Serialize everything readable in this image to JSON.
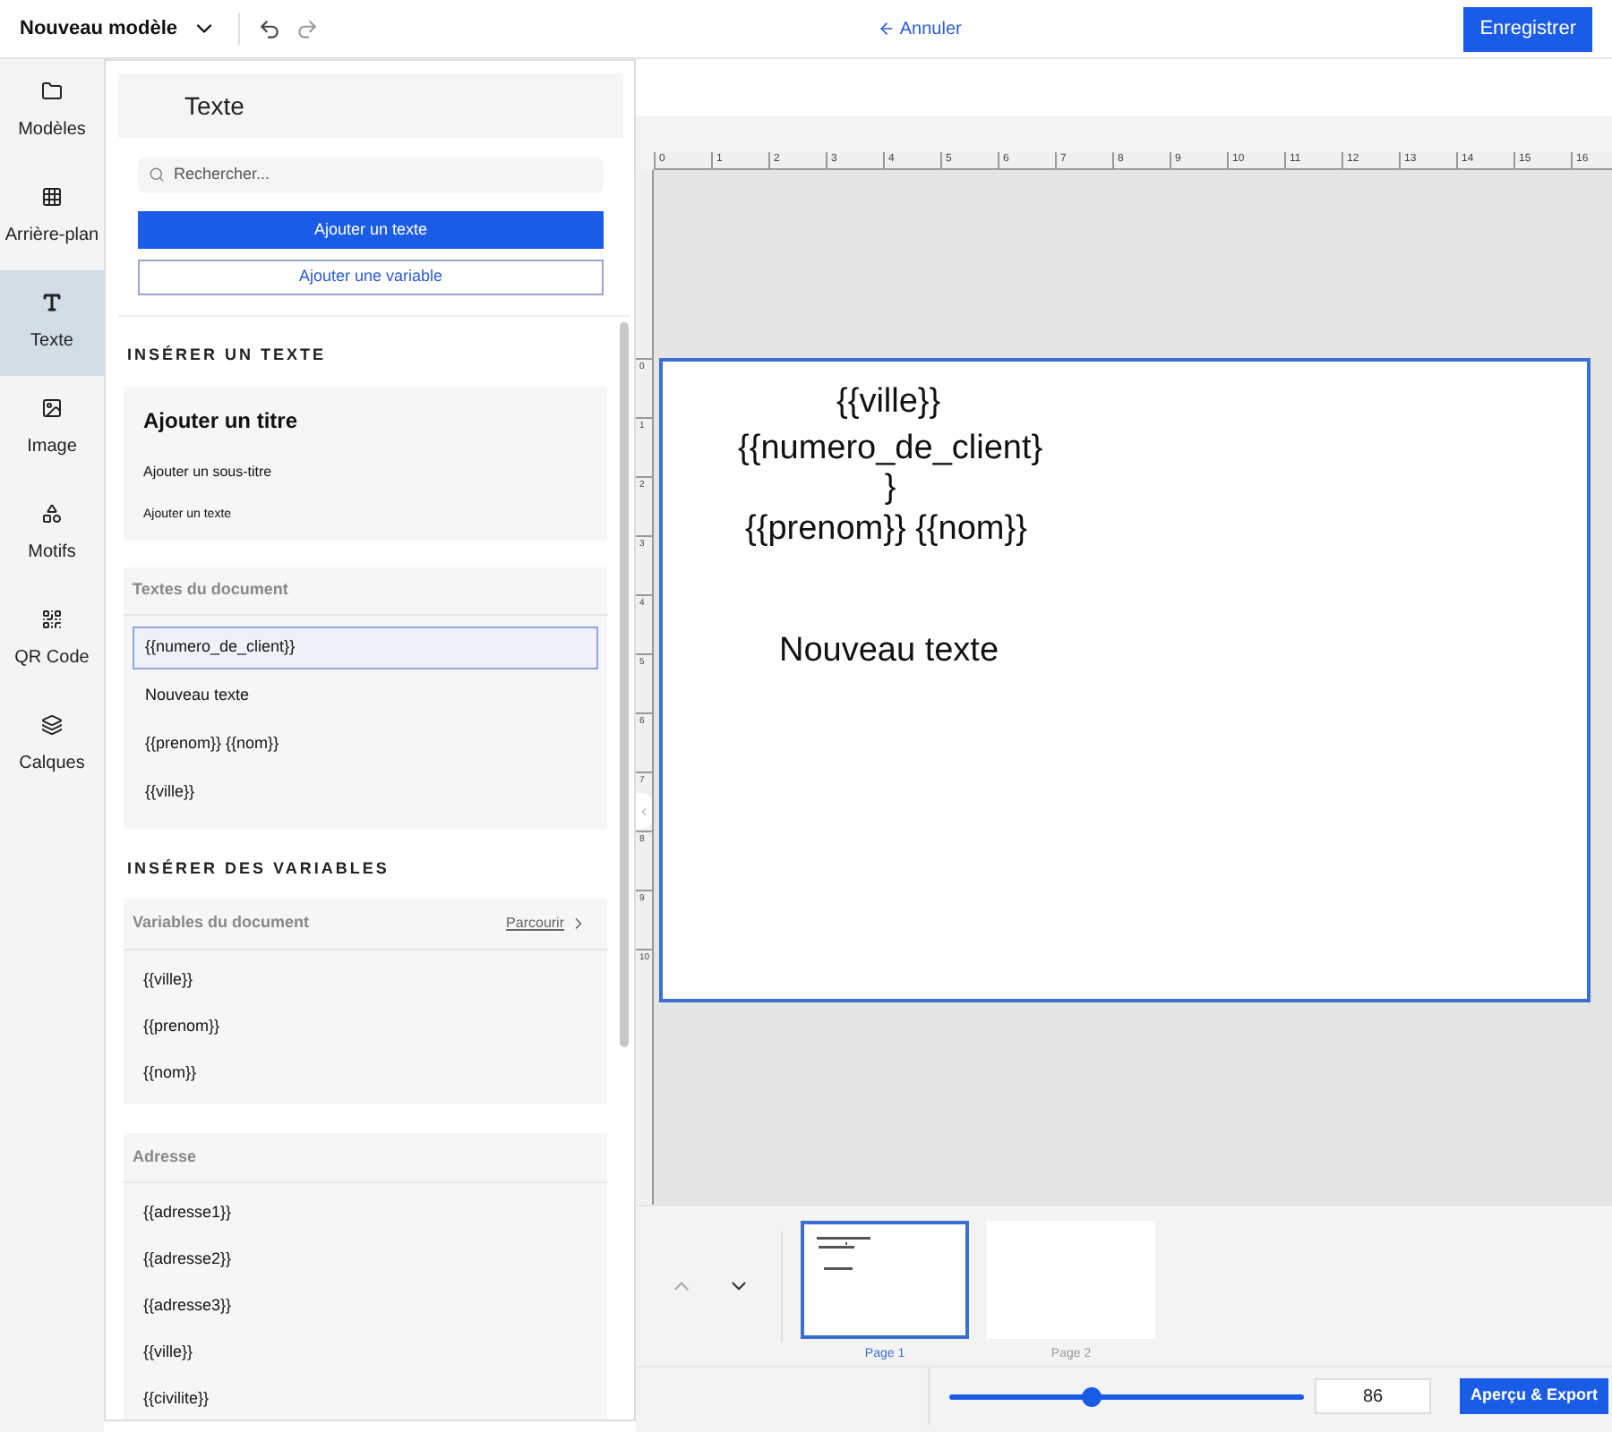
{
  "header": {
    "template_name": "Nouveau modèle",
    "cancel": "Annuler",
    "save": "Enregistrer"
  },
  "rail": [
    {
      "label": "Modèles",
      "selected": false
    },
    {
      "label": "Arrière-plan",
      "selected": false
    },
    {
      "label": "Texte",
      "selected": true
    },
    {
      "label": "Image",
      "selected": false
    },
    {
      "label": "Motifs",
      "selected": false
    },
    {
      "label": "QR Code",
      "selected": false
    },
    {
      "label": "Calques",
      "selected": false
    }
  ],
  "panel": {
    "title": "Texte",
    "search_placeholder": "Rechercher...",
    "primary_button": "Ajouter un texte",
    "secondary_button": "Ajouter une variable",
    "insert_text": {
      "heading": "INSÉRER UN TEXTE",
      "presets": [
        {
          "kind": "title",
          "label": "Ajouter un titre"
        },
        {
          "kind": "subtitle",
          "label": "Ajouter un sous-titre"
        },
        {
          "kind": "body",
          "label": "Ajouter un texte"
        }
      ]
    },
    "document_texts": {
      "title": "Textes du document",
      "items": [
        {
          "label": "{{numero_de_client}}",
          "selected": true
        },
        {
          "label": "Nouveau texte",
          "selected": false
        },
        {
          "label": "{{prenom}} {{nom}}",
          "selected": false
        },
        {
          "label": "{{ville}}",
          "selected": false
        }
      ]
    },
    "insert_variables": {
      "heading": "INSÉRER DES VARIABLES",
      "groups": [
        {
          "title": "Variables du document",
          "link": "Parcourir",
          "items": [
            "{{ville}}",
            "{{prenom}}",
            "{{nom}}"
          ]
        },
        {
          "title": "Adresse",
          "items": [
            "{{adresse1}}",
            "{{adresse2}}",
            "{{adresse3}}",
            "{{ville}}",
            "{{civilite}}"
          ]
        }
      ]
    }
  },
  "rulers": {
    "horizontal": [
      "0",
      "1",
      "2",
      "3",
      "4",
      "5",
      "6",
      "7",
      "8",
      "9",
      "10",
      "11",
      "12",
      "13",
      "14",
      "15",
      "16"
    ],
    "vertical": [
      "0",
      "1",
      "2",
      "3",
      "4",
      "5",
      "6",
      "7",
      "8",
      "9",
      "10"
    ]
  },
  "canvas": {
    "elements": [
      {
        "kind": "plain",
        "text": "{{ville}}"
      },
      {
        "kind": "wrapped",
        "text": "{{numero_de_client}}"
      },
      {
        "kind": "plain",
        "text": "{{prenom}} {{nom}}"
      },
      {
        "kind": "plain",
        "text": "Nouveau texte"
      }
    ]
  },
  "pages": [
    {
      "label": "Page 1",
      "selected": true,
      "kind": "filled"
    },
    {
      "label": "Page 2",
      "selected": false,
      "kind": "blank"
    }
  ],
  "zoom": {
    "level": 0.4,
    "value": "86"
  },
  "export_button": "Aperçu & Export"
}
